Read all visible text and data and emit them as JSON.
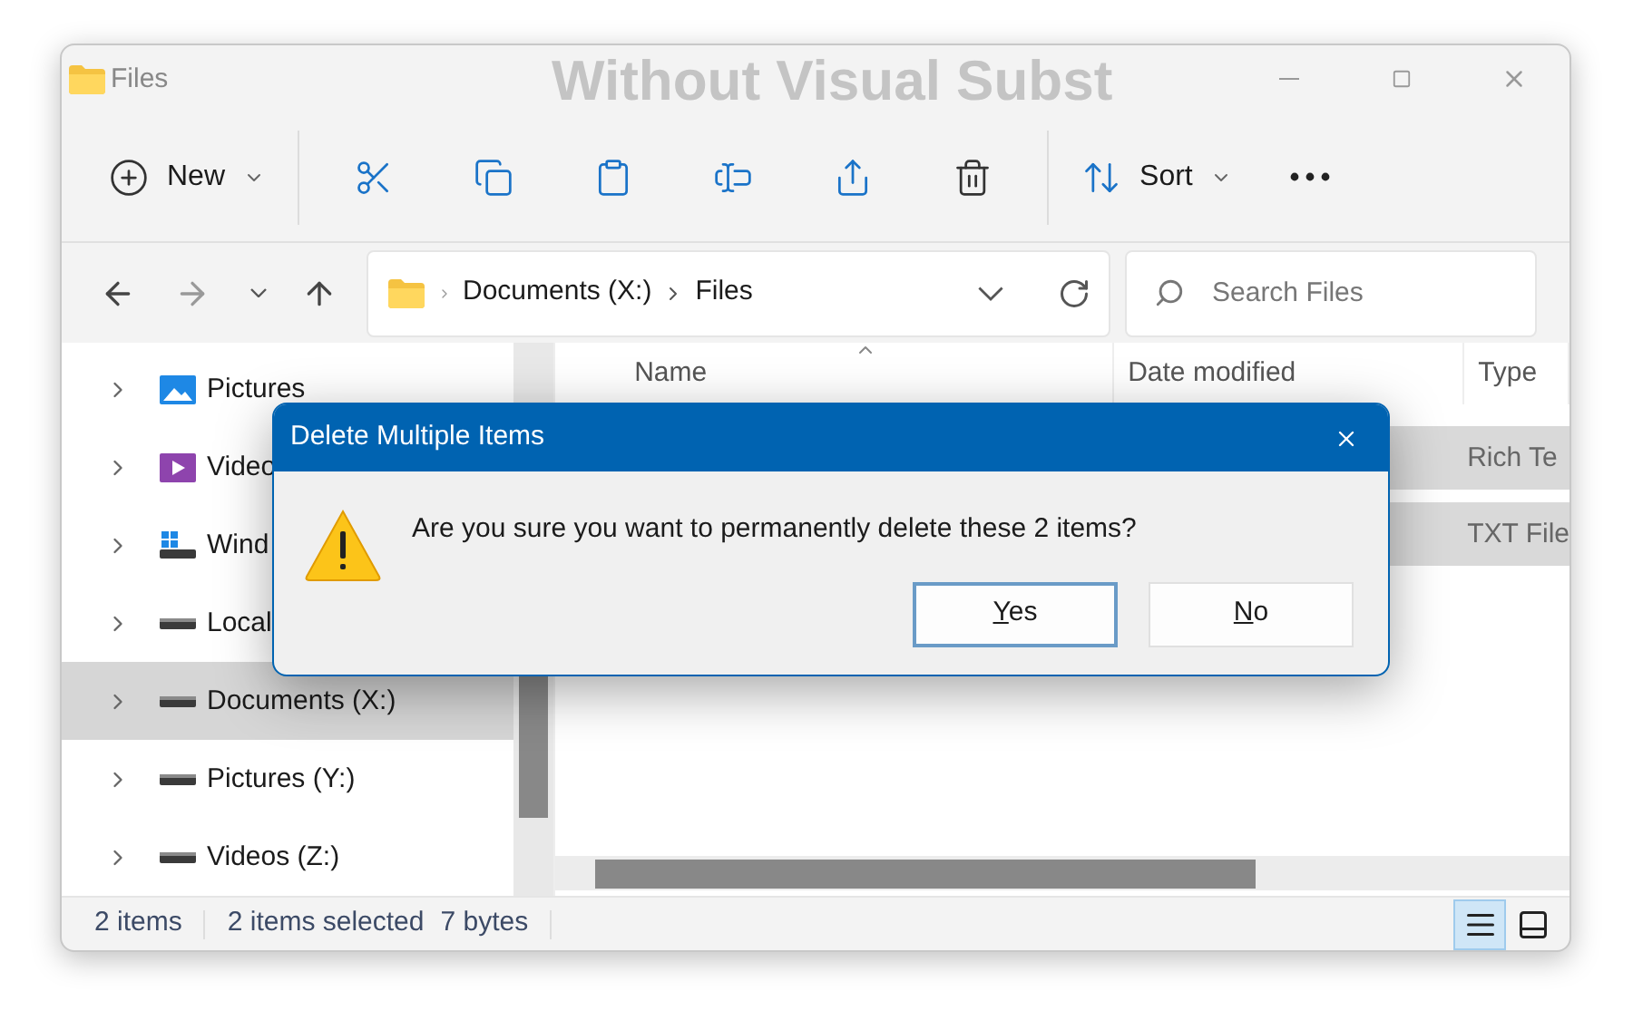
{
  "window": {
    "title": "Files",
    "overlay_title": "Without Visual Subst"
  },
  "toolbar": {
    "items": [
      {
        "kind": "new",
        "label": "New"
      },
      {
        "kind": "cut"
      },
      {
        "kind": "copy"
      },
      {
        "kind": "paste"
      },
      {
        "kind": "rename"
      },
      {
        "kind": "share"
      },
      {
        "kind": "delete"
      },
      {
        "kind": "sort",
        "label": "Sort"
      },
      {
        "kind": "more"
      }
    ]
  },
  "address": {
    "crumbs": [
      "Documents (X:)",
      "Files"
    ]
  },
  "search": {
    "placeholder": "Search Files"
  },
  "sidebar": {
    "items": [
      {
        "label": "Pictures",
        "kind": "pictures",
        "selected": false
      },
      {
        "label": "Video",
        "kind": "videos",
        "selected": false
      },
      {
        "label": "Wind",
        "kind": "windows",
        "selected": false
      },
      {
        "label": "Local",
        "kind": "drive",
        "selected": false
      },
      {
        "label": "Documents (X:)",
        "kind": "drive",
        "selected": true
      },
      {
        "label": "Pictures (Y:)",
        "kind": "drive",
        "selected": false
      },
      {
        "label": "Videos (Z:)",
        "kind": "drive",
        "selected": false
      }
    ]
  },
  "file_list": {
    "columns": [
      "Name",
      "Date modified",
      "Type"
    ],
    "rows": [
      {
        "type": "Rich Te",
        "selected": true
      },
      {
        "type": "TXT File",
        "selected": true
      }
    ]
  },
  "status_bar": {
    "count": "2 items",
    "selection": "2 items selected",
    "size": "7 bytes",
    "views": [
      {
        "kind": "details",
        "selected": true
      },
      {
        "kind": "tiles",
        "selected": false
      }
    ]
  },
  "dialog": {
    "title": "Delete Multiple Items",
    "message": "Are you sure you want to permanently delete these 2 items?",
    "buttons": [
      {
        "label": "Yes",
        "default": true
      },
      {
        "label": "No",
        "default": false
      }
    ]
  }
}
